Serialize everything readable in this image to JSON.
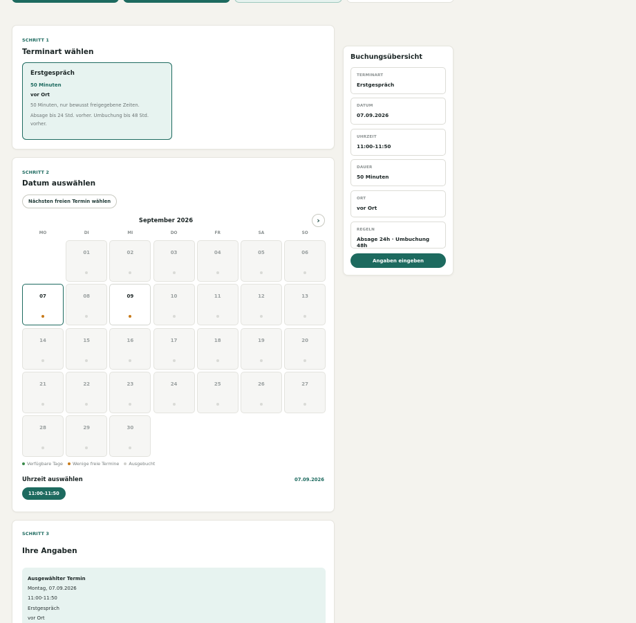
{
  "step1": {
    "label": "SCHRITT 1",
    "title": "Terminart wählen",
    "type": {
      "name": "Erstgespräch",
      "duration": "50 Minuten",
      "location": "vor Ort",
      "description": "50 Minuten, nur bewusst freigegebene Zeiten.",
      "rules": "Absage bis 24 Std. vorher. Umbuchung bis 48 Std. vorher."
    }
  },
  "step2": {
    "label": "SCHRITT 2",
    "title": "Datum auswählen",
    "next_free_button": "Nächsten freien Termin wählen",
    "month": "September 2026",
    "next_month_icon": "›",
    "weekdays": [
      "MO",
      "DI",
      "MI",
      "DO",
      "FR",
      "SA",
      "SO"
    ],
    "days": [
      "01",
      "02",
      "03",
      "04",
      "05",
      "06",
      "07",
      "08",
      "09",
      "10",
      "11",
      "12",
      "13",
      "14",
      "15",
      "16",
      "17",
      "18",
      "19",
      "20",
      "21",
      "22",
      "23",
      "24",
      "25",
      "26",
      "27",
      "28",
      "29",
      "30"
    ],
    "first_weekday_offset": 1,
    "available_days": [
      "07",
      "09"
    ],
    "selected_day": "07",
    "legend": {
      "available": "Verfügbare Tage",
      "few": "Wenige freie Termine",
      "booked": "Ausgebucht"
    },
    "time_title": "Uhrzeit auswählen",
    "selected_date": "07.09.2026",
    "slot": "11:00-11:50"
  },
  "step3": {
    "label": "SCHRITT 3",
    "title": "Ihre Angaben",
    "selected_title": "Ausgewählter Termin",
    "selected_lines": [
      "Montag, 07.09.2026",
      "11:00-11:50",
      "Erstgespräch",
      "vor Ort"
    ]
  },
  "summary": {
    "title": "Buchungsübersicht",
    "items": [
      {
        "key": "TERMINART",
        "value": "Erstgespräch"
      },
      {
        "key": "DATUM",
        "value": "07.09.2026"
      },
      {
        "key": "UHRZEIT",
        "value": "11:00-11:50"
      },
      {
        "key": "DAUER",
        "value": "50 Minuten"
      },
      {
        "key": "ORT",
        "value": "vor Ort"
      },
      {
        "key": "REGELN",
        "value": "Absage 24h · Umbuchung 48h"
      }
    ],
    "cta": "Angaben eingeben"
  },
  "colors": {
    "accent": "#1d6a5f",
    "accent_light": "#e7f3f0",
    "available_dot": "#3a8a4a",
    "few_dot": "#c77a1a",
    "booked_dot": "#d0d0cc",
    "background": "#f4f3ee"
  }
}
